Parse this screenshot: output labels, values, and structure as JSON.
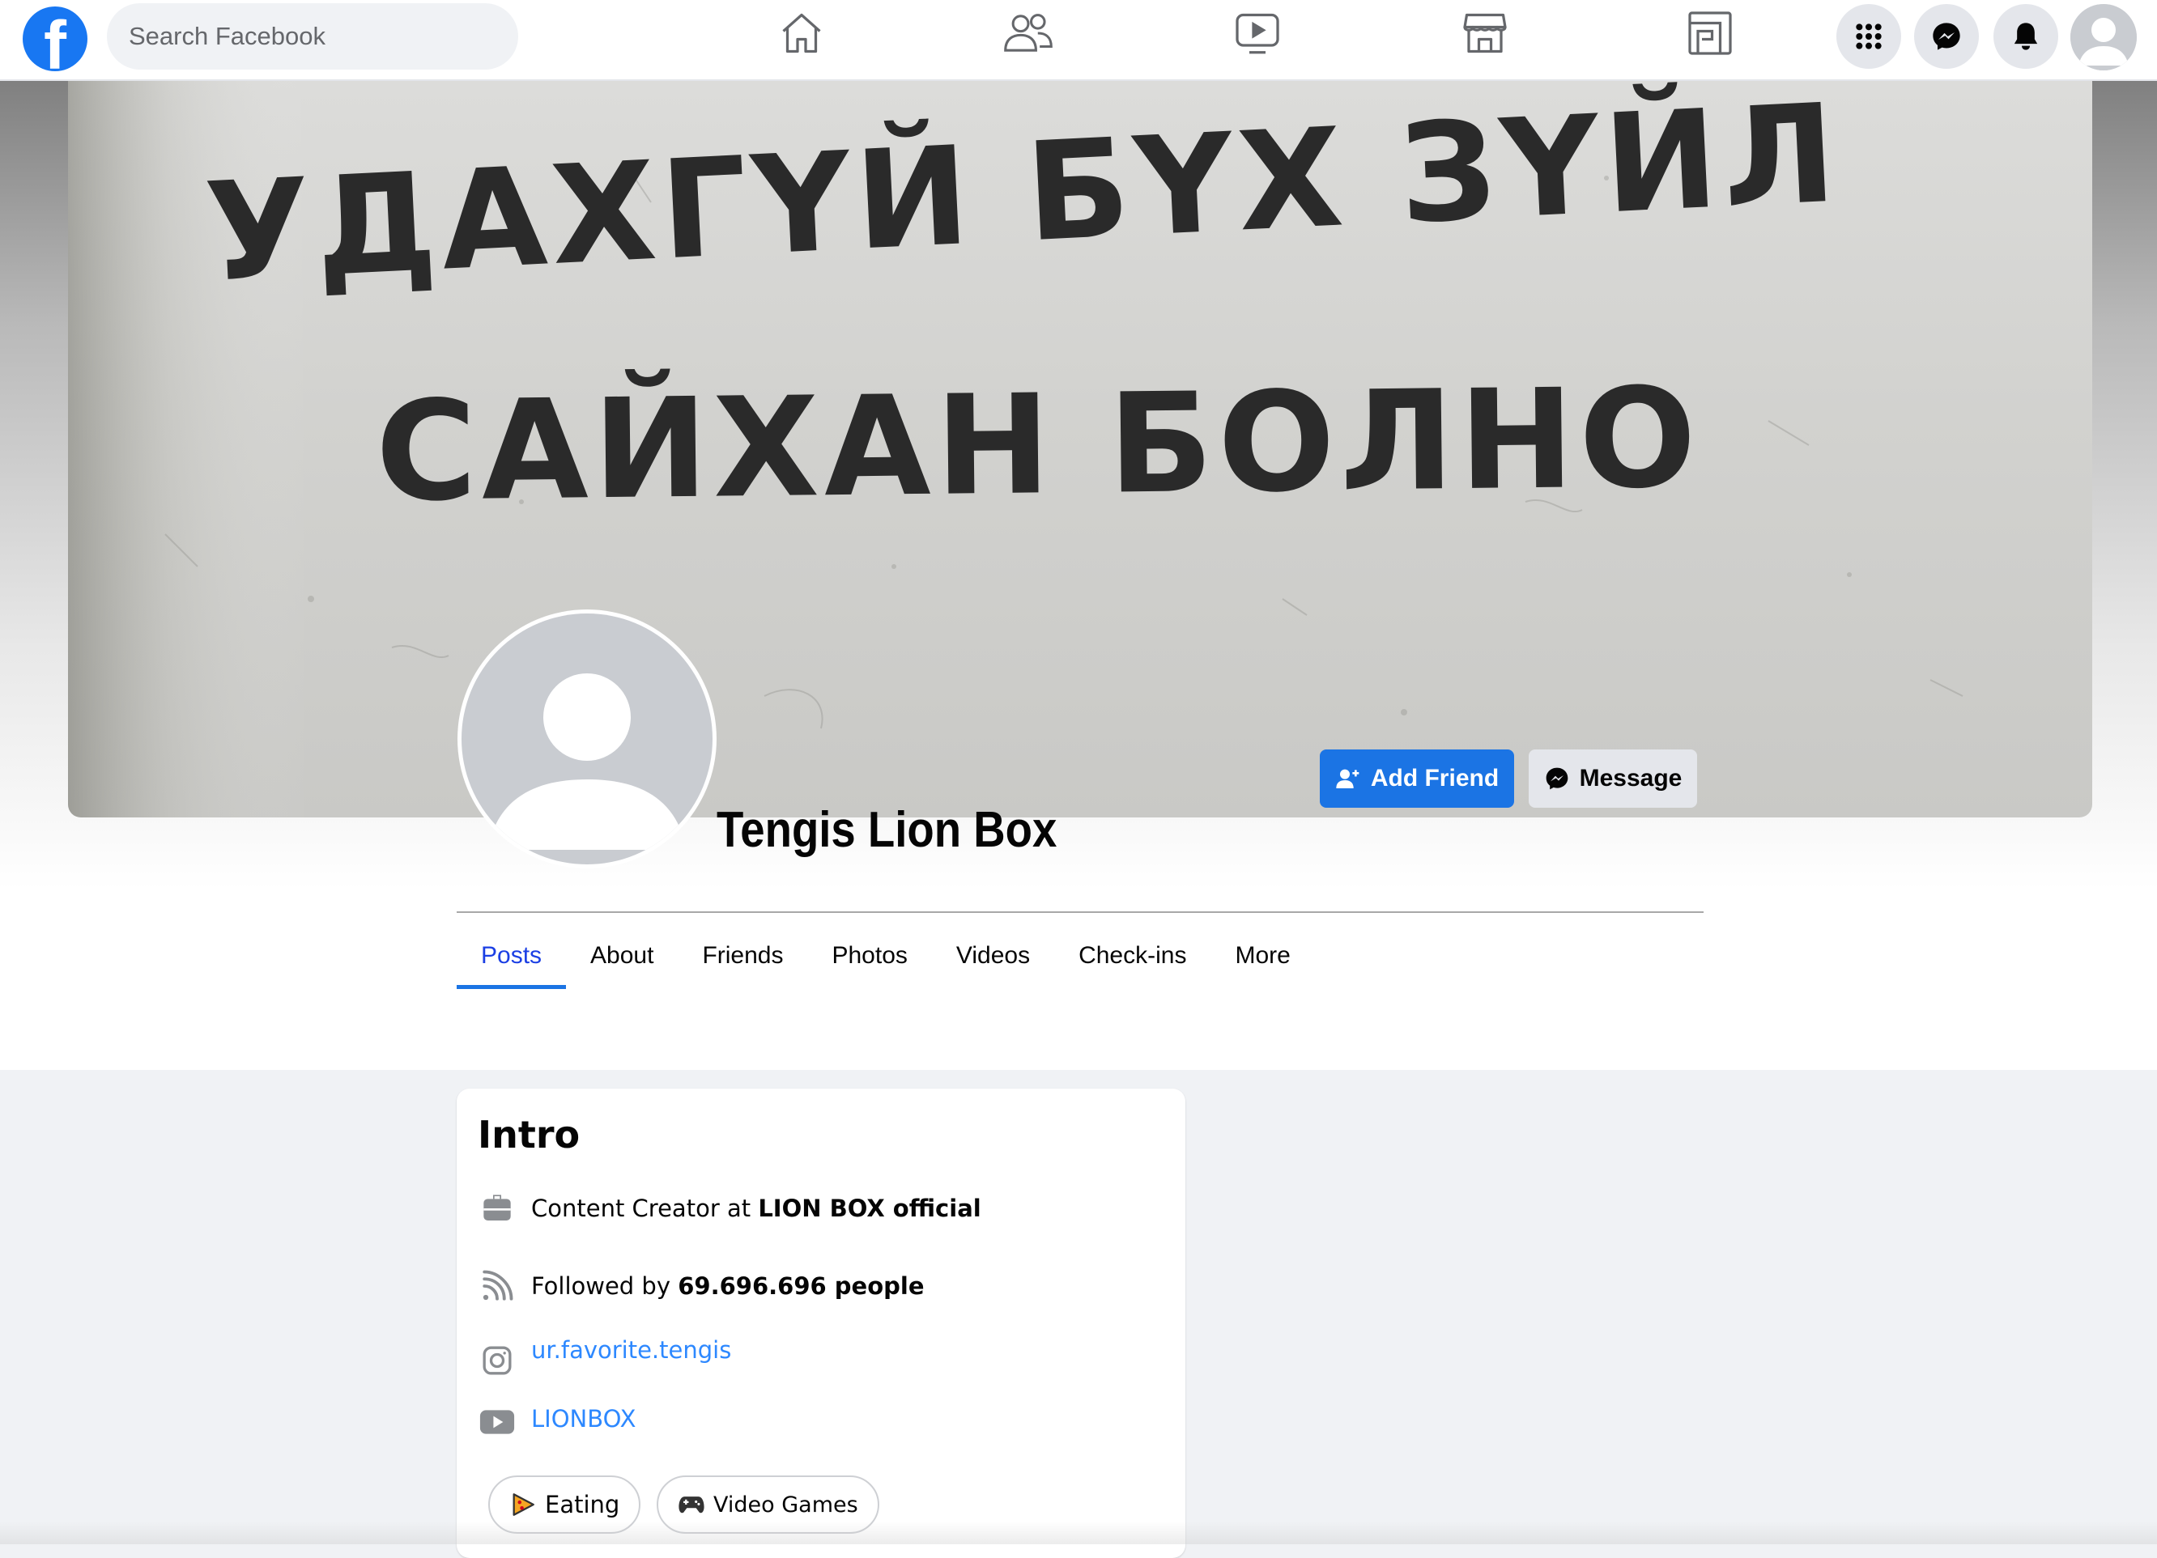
{
  "nav": {
    "search_placeholder": "Search Facebook",
    "icons": [
      "home-icon",
      "friends-icon",
      "watch-icon",
      "marketplace-icon",
      "gaming-icon",
      "menu-icon",
      "messenger-icon",
      "notifications-icon",
      "profile-icon"
    ]
  },
  "cover": {
    "line1": "УДАХГҮЙ БҮХ ЗҮЙЛ",
    "line2": "САЙХАН БОЛНО"
  },
  "profile": {
    "name": "Tengis Lion Box",
    "add_friend_label": "Add Friend",
    "message_label": "Message"
  },
  "tabs": [
    "Posts",
    "About",
    "Friends",
    "Photos",
    "Videos",
    "Check-ins",
    "More"
  ],
  "intro": {
    "title": "Intro",
    "work_prefix": "Content Creator at ",
    "work_company": "LION BOX official",
    "followers_prefix": "Followed by ",
    "followers_count": "69.696.696 people",
    "instagram": "ur.favorite.tengis",
    "youtube": "LIONBOX",
    "hobbies": [
      "Eating",
      "Video Games"
    ]
  },
  "colors": {
    "brand_blue": "#1877f2",
    "button_blue": "#1b74e4",
    "link_blue": "#2d88ff",
    "page_bg": "#f0f2f5"
  }
}
